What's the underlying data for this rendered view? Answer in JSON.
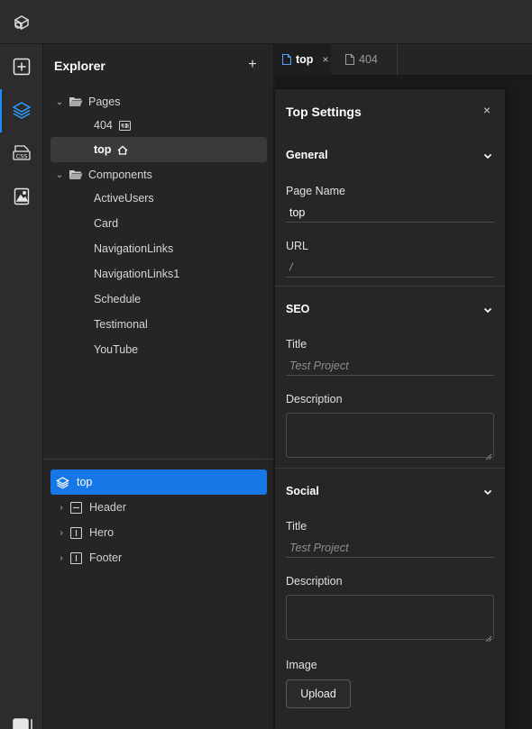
{
  "explorer": {
    "title": "Explorer",
    "add_label": "+",
    "pages_folder": "Pages",
    "pages": [
      {
        "label": "404"
      },
      {
        "label": "top"
      }
    ],
    "components_folder": "Components",
    "components": [
      "ActiveUsers",
      "Card",
      "NavigationLinks",
      "NavigationLinks1",
      "Schedule",
      "Testimonal",
      "YouTube"
    ]
  },
  "layers": {
    "root": "top",
    "children": [
      "Header",
      "Hero",
      "Footer"
    ]
  },
  "tabs": [
    {
      "label": "top",
      "close": "×"
    },
    {
      "label": "404"
    }
  ],
  "settings": {
    "title": "Top Settings",
    "close": "×",
    "general": {
      "title": "General",
      "page_name_label": "Page Name",
      "page_name_value": "top",
      "url_label": "URL",
      "url_value": "/"
    },
    "seo": {
      "title": "SEO",
      "title_label": "Title",
      "title_placeholder": "Test Project",
      "description_label": "Description"
    },
    "social": {
      "title": "Social",
      "title_label": "Title",
      "title_placeholder": "Test Project",
      "description_label": "Description",
      "image_label": "Image",
      "upload_label": "Upload"
    }
  },
  "colors": {
    "accent": "#1677e6",
    "rail_active": "#1a8cff"
  }
}
